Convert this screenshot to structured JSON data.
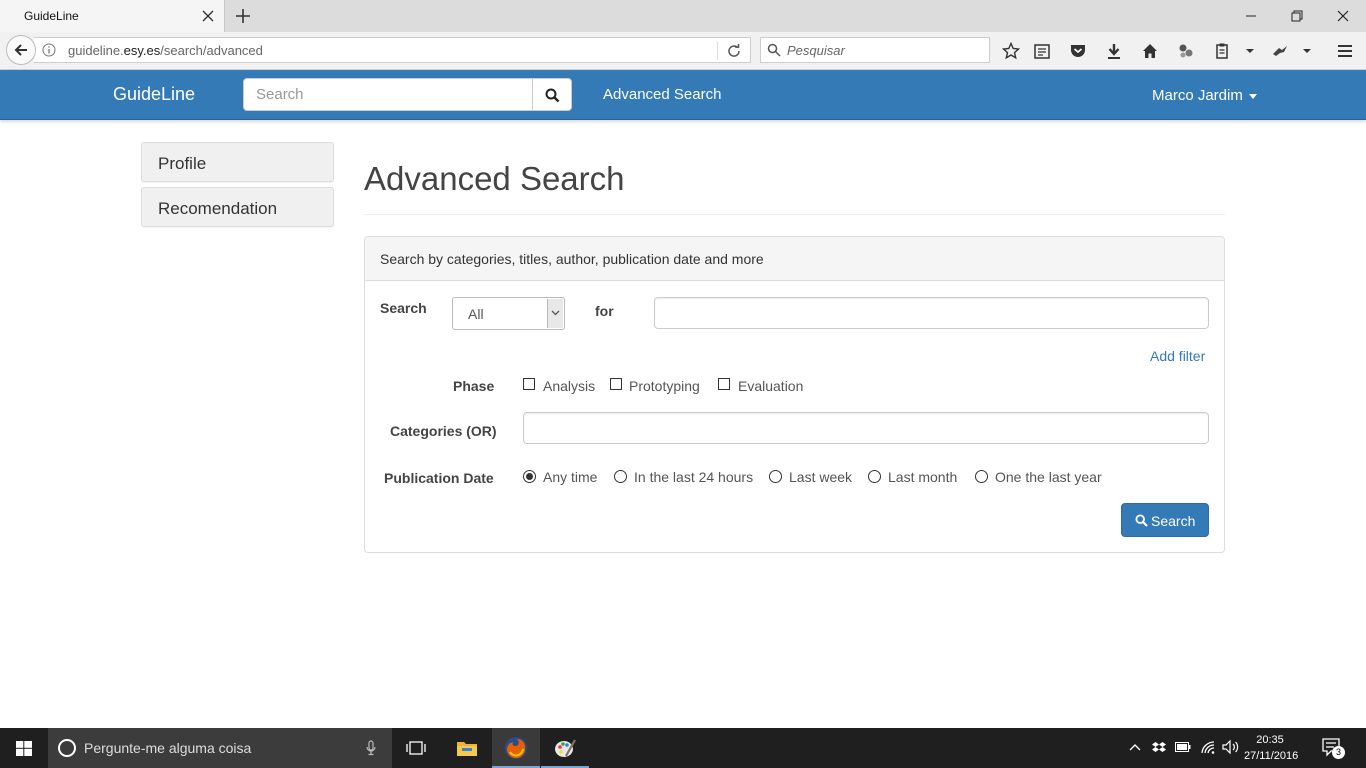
{
  "browser": {
    "tab_title": "GuideLine",
    "url_prefix": "guideline.",
    "url_domain": "esy.es",
    "url_path": "/search/advanced",
    "search_placeholder": "Pesquisar"
  },
  "header": {
    "brand": "GuideLine",
    "search_placeholder": "Search",
    "nav_link": "Advanced Search",
    "user_name": "Marco Jardim"
  },
  "sidebar": {
    "items": [
      {
        "label": "Profile"
      },
      {
        "label": "Recomendation"
      }
    ]
  },
  "main": {
    "title": "Advanced Search",
    "panel_heading": "Search by categories, titles, author, publication date and more",
    "search_label": "Search",
    "search_scope": "All",
    "for_label": "for",
    "for_value": "",
    "add_filter": "Add filter",
    "phase_label": "Phase",
    "phases": [
      {
        "label": "Analysis",
        "checked": false
      },
      {
        "label": "Prototyping",
        "checked": false
      },
      {
        "label": "Evaluation",
        "checked": false
      }
    ],
    "categories_label": "Categories (OR)",
    "categories_value": "",
    "pubdate_label": "Publication Date",
    "pubdate_options": [
      {
        "label": "Any time",
        "selected": true
      },
      {
        "label": "In the last 24 hours",
        "selected": false
      },
      {
        "label": "Last week",
        "selected": false
      },
      {
        "label": "Last month",
        "selected": false
      },
      {
        "label": "One the last year",
        "selected": false
      }
    ],
    "submit_label": "Search"
  },
  "taskbar": {
    "cortana_placeholder": "Pergunte-me alguma coisa",
    "time": "20:35",
    "date": "27/11/2016",
    "notification_count": "3"
  },
  "colors": {
    "brand_blue": "#337ab7",
    "taskbar": "#1f1f1f"
  }
}
